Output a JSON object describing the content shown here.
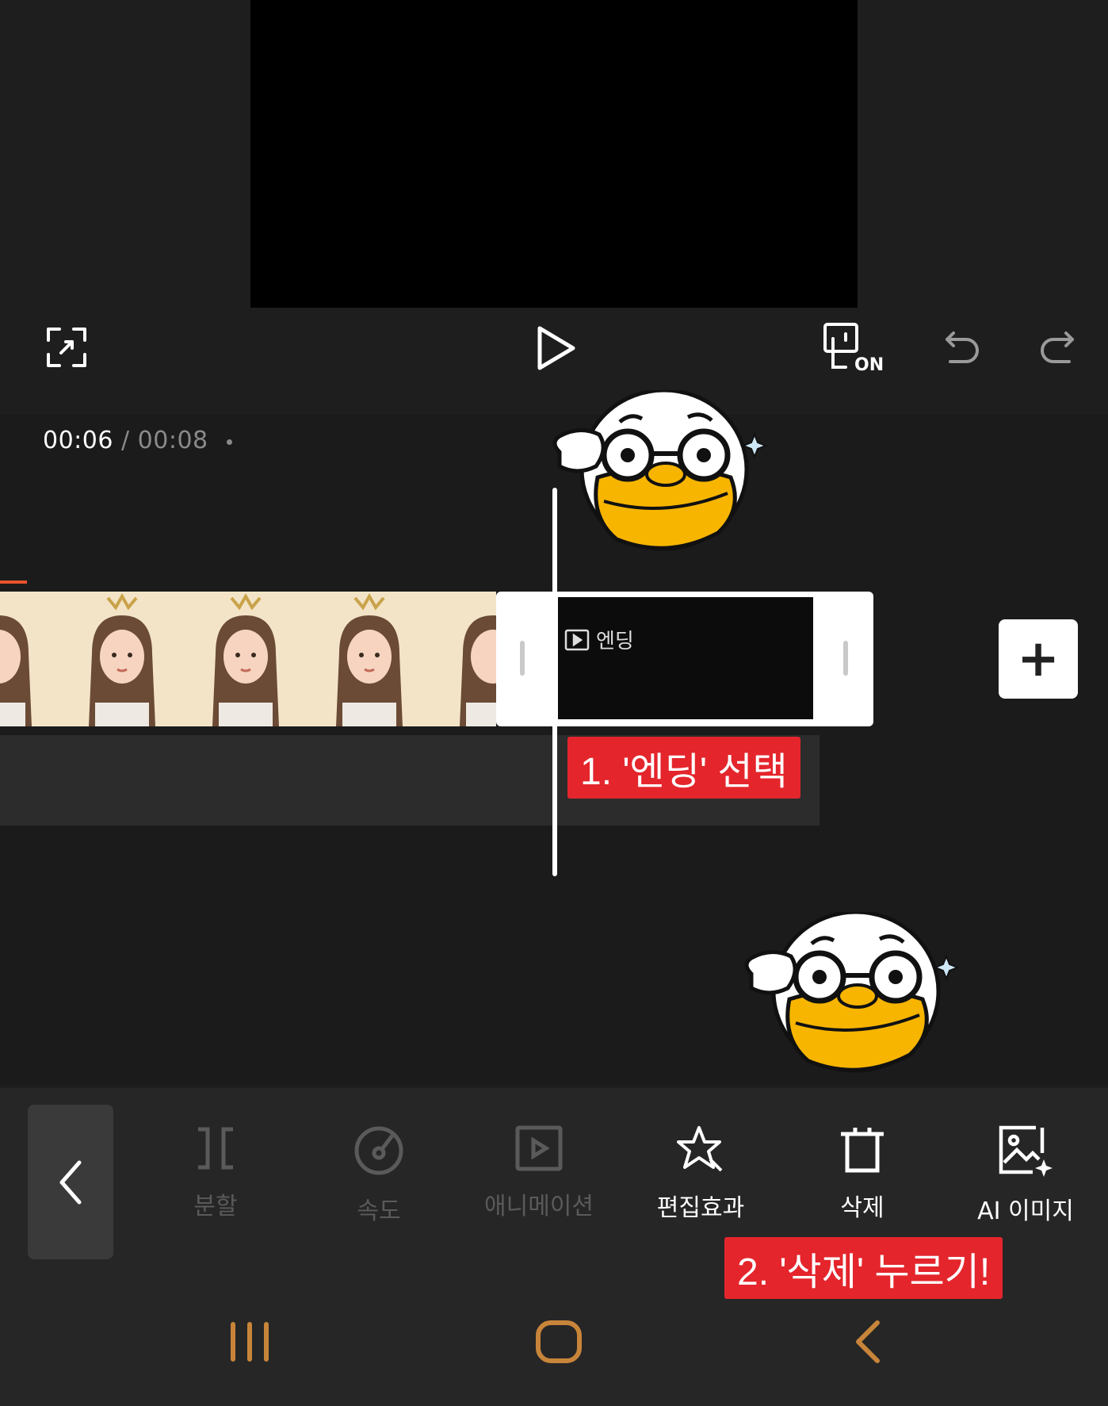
{
  "player": {
    "current_time": "00:06",
    "separator": "/",
    "total_time": "00:08",
    "controls": [
      "fullscreen-icon",
      "play-icon",
      "preview-toggle-icon",
      "undo-icon",
      "redo-icon"
    ],
    "preview_toggle_badge": "ON"
  },
  "timeline": {
    "ending_clip_label": "엔딩",
    "add_button_label": "+"
  },
  "callouts": {
    "step1": "1. '엔딩' 선택",
    "step2": "2. '삭제' 누르기!"
  },
  "toolbar": {
    "back_icon": "chevron-left-icon",
    "tools": [
      {
        "label": "분할",
        "icon": "split-icon",
        "enabled": false
      },
      {
        "label": "속도",
        "icon": "speed-icon",
        "enabled": false
      },
      {
        "label": "애니메이션",
        "icon": "animation-icon",
        "enabled": false
      },
      {
        "label": "편집효과",
        "icon": "effect-icon",
        "enabled": true
      },
      {
        "label": "삭제",
        "icon": "delete-icon",
        "enabled": true
      },
      {
        "label": "AI 이미지",
        "icon": "ai-image-icon",
        "enabled": true
      }
    ]
  },
  "navigation": [
    "recent-apps-icon",
    "home-icon",
    "back-icon"
  ],
  "colors": {
    "accent_orange": "#e8532f",
    "callout_red": "#e4252c",
    "nav_icon": "#c8853a",
    "background": "#1e1e1e"
  }
}
